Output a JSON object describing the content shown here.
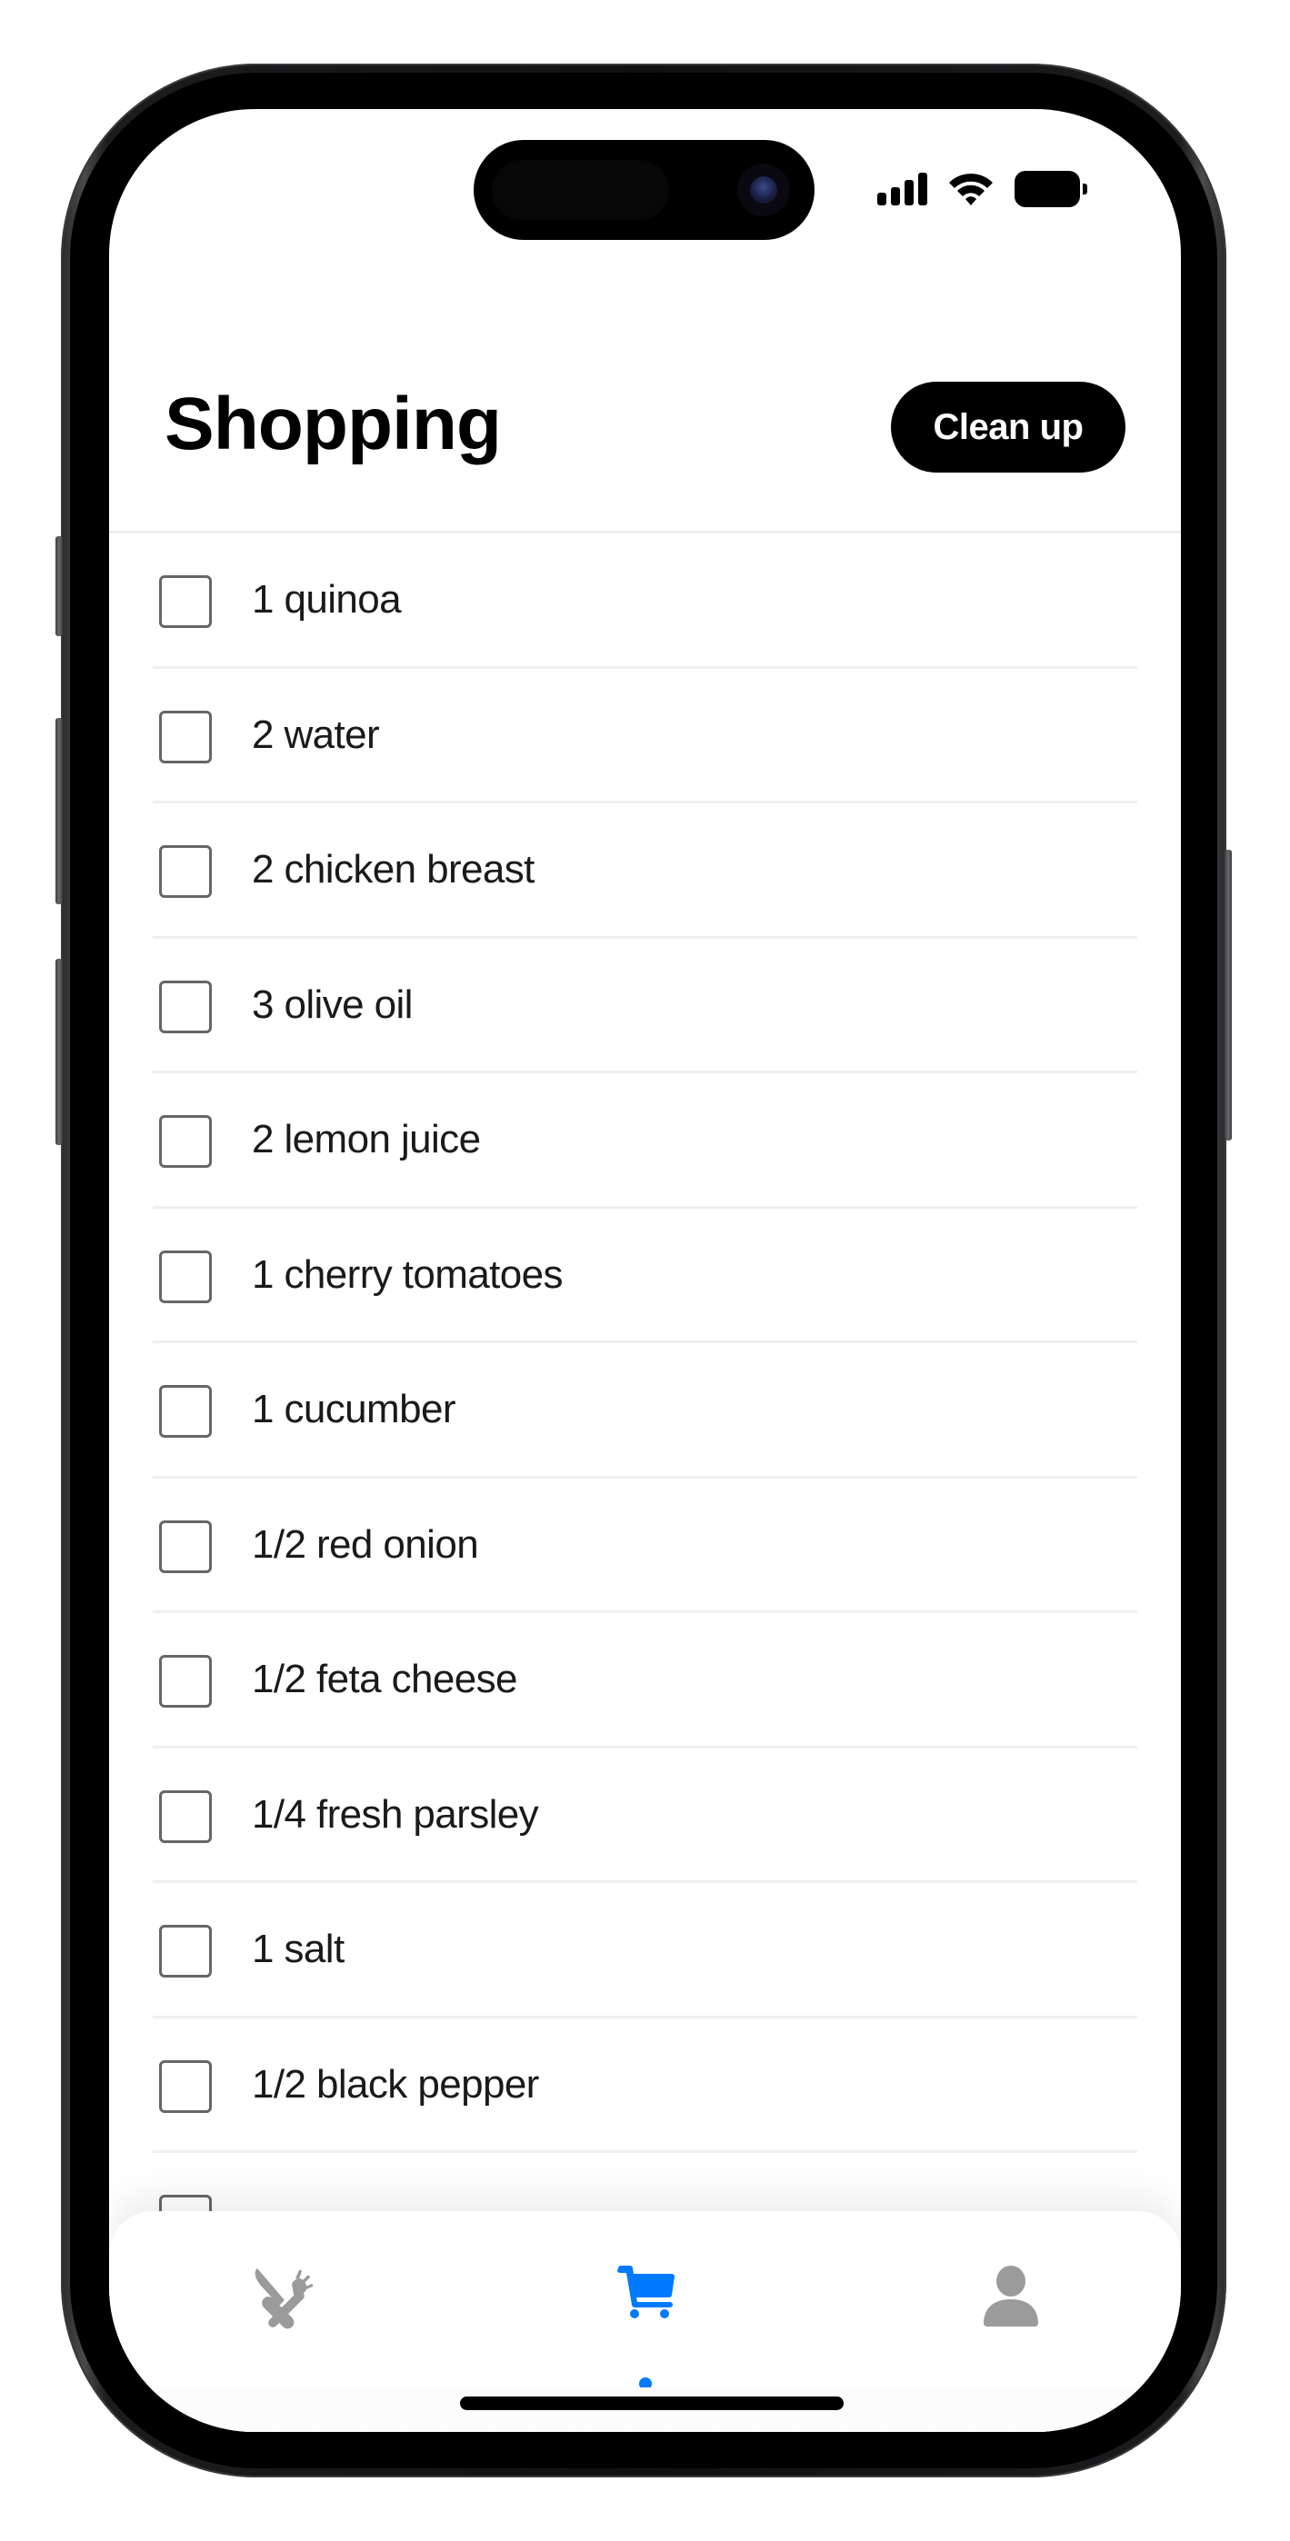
{
  "status_bar": {
    "icons": [
      "signal-icon",
      "wifi-icon",
      "battery-icon"
    ]
  },
  "header": {
    "title": "Shopping",
    "cleanup_label": "Clean up"
  },
  "shopping_list": {
    "items": [
      {
        "label": "1 quinoa",
        "checked": false
      },
      {
        "label": "2 water",
        "checked": false
      },
      {
        "label": "2 chicken breast",
        "checked": false
      },
      {
        "label": "3 olive oil",
        "checked": false
      },
      {
        "label": "2 lemon juice",
        "checked": false
      },
      {
        "label": "1 cherry tomatoes",
        "checked": false
      },
      {
        "label": "1 cucumber",
        "checked": false
      },
      {
        "label": "1/2 red onion",
        "checked": false
      },
      {
        "label": "1/2 feta cheese",
        "checked": false
      },
      {
        "label": "1/4 fresh parsley",
        "checked": false
      },
      {
        "label": "1 salt",
        "checked": false
      },
      {
        "label": "1/2 black pepper",
        "checked": false
      },
      {
        "label": "",
        "checked": false
      }
    ]
  },
  "tab_bar": {
    "tabs": [
      {
        "id": "recipes",
        "icon": "utensils-icon",
        "active": false
      },
      {
        "id": "shopping",
        "icon": "cart-icon",
        "active": true
      },
      {
        "id": "profile",
        "icon": "person-icon",
        "active": false
      }
    ],
    "active_color": "#007AFF",
    "inactive_color": "#9B9B9B"
  }
}
